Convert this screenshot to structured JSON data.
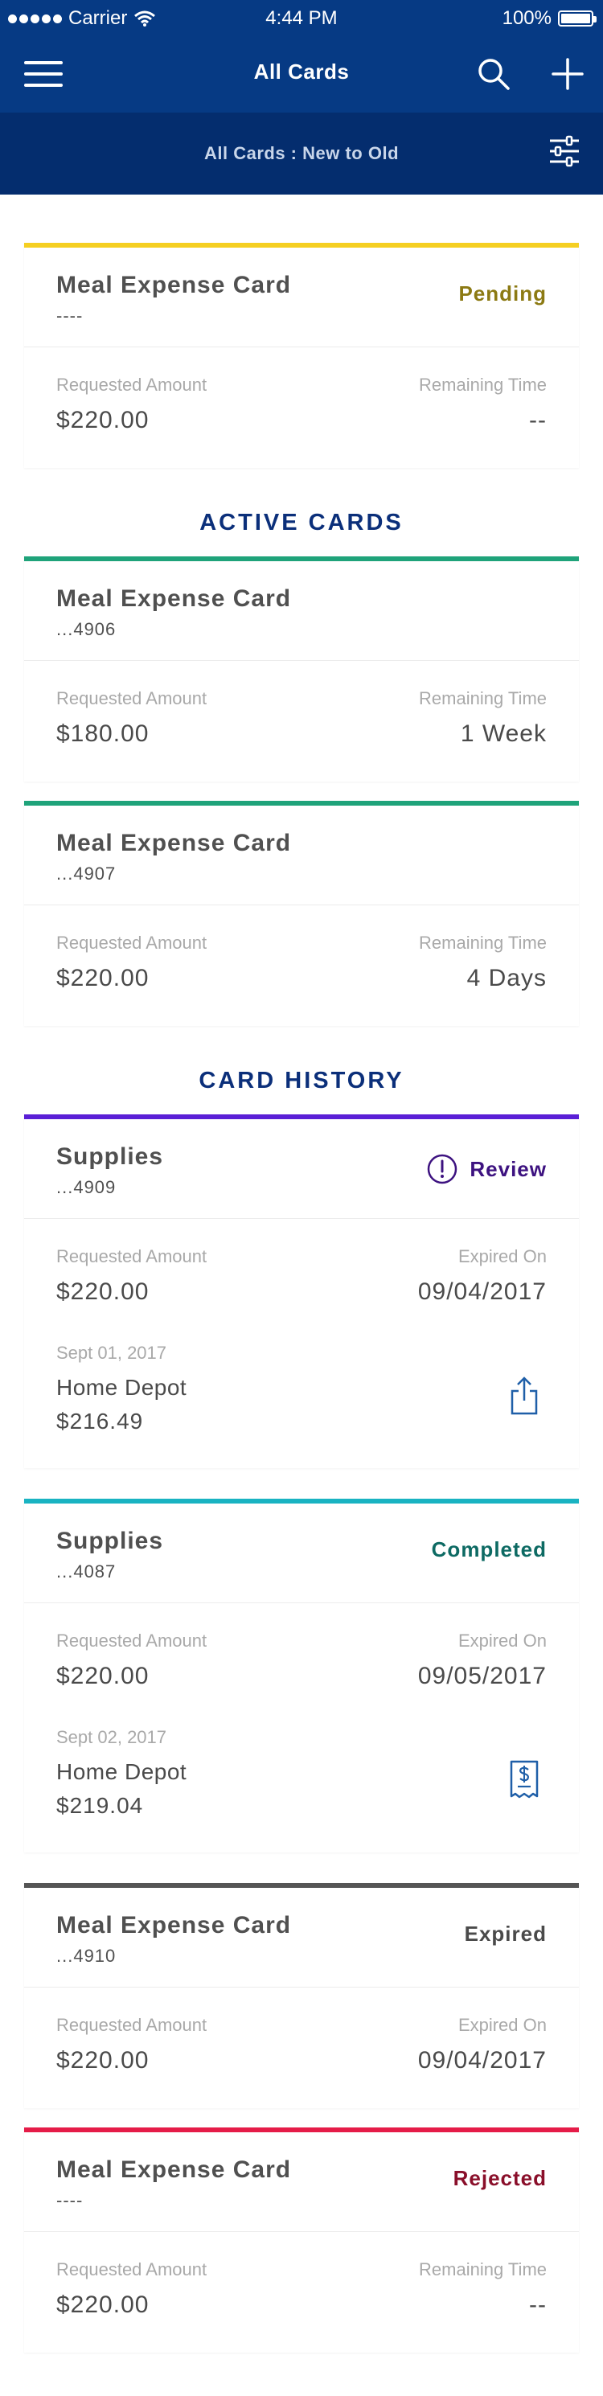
{
  "status_bar": {
    "carrier": "Carrier",
    "time": "4:44 PM",
    "battery": "100%"
  },
  "nav": {
    "title": "All Cards"
  },
  "filter": {
    "label": "All Cards : New to Old"
  },
  "sections": {
    "active": "ACTIVE CARDS",
    "history": "CARD HISTORY"
  },
  "colors": {
    "nav_bg": "#063a84",
    "pending": "#f5cf22",
    "active": "#1fa37a",
    "review": "#5a1fd6",
    "completed": "#19b3c2",
    "expired": "#555555",
    "rejected": "#e51c48"
  },
  "cards": [
    {
      "title": "Meal Expense Card",
      "number": "----",
      "status": "Pending",
      "left_label": "Requested Amount",
      "left_value": "$220.00",
      "right_label": "Remaining Time",
      "right_value": "--"
    },
    {
      "title": "Meal Expense Card",
      "number": "...4906",
      "status": "",
      "left_label": "Requested Amount",
      "left_value": "$180.00",
      "right_label": "Remaining Time",
      "right_value": "1 Week"
    },
    {
      "title": "Meal Expense Card",
      "number": "...4907",
      "status": "",
      "left_label": "Requested Amount",
      "left_value": "$220.00",
      "right_label": "Remaining Time",
      "right_value": "4 Days"
    },
    {
      "title": "Supplies",
      "number": "...4909",
      "status": "Review",
      "status_icon": "alert-circle-icon",
      "left_label": "Requested Amount",
      "left_value": "$220.00",
      "right_label": "Expired On",
      "right_value": "09/04/2017",
      "transaction": {
        "date": "Sept 01, 2017",
        "merchant": "Home Depot",
        "amount": "$216.49",
        "icon": "share-icon"
      }
    },
    {
      "title": "Supplies",
      "number": "...4087",
      "status": "Completed",
      "left_label": "Requested Amount",
      "left_value": "$220.00",
      "right_label": "Expired On",
      "right_value": "09/05/2017",
      "transaction": {
        "date": "Sept 02, 2017",
        "merchant": "Home Depot",
        "amount": "$219.04",
        "icon": "receipt-icon"
      }
    },
    {
      "title": "Meal Expense Card",
      "number": "...4910",
      "status": "Expired",
      "left_label": "Requested Amount",
      "left_value": "$220.00",
      "right_label": "Expired On",
      "right_value": "09/04/2017"
    },
    {
      "title": "Meal Expense Card",
      "number": "----",
      "status": "Rejected",
      "left_label": "Requested Amount",
      "left_value": "$220.00",
      "right_label": "Remaining Time",
      "right_value": "--"
    }
  ]
}
